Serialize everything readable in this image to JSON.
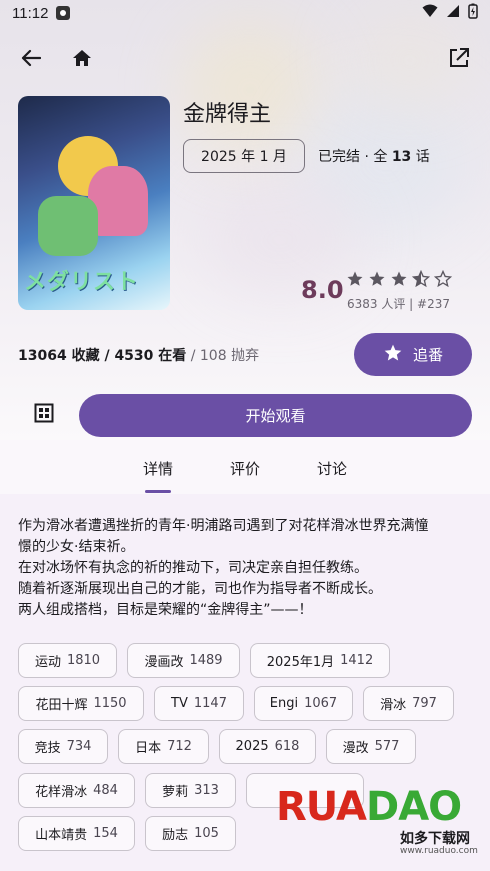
{
  "status_bar": {
    "time": "11:12"
  },
  "anime": {
    "title": "金牌得主",
    "date": "2025 年 1 月",
    "status_prefix": "已完结 · 全 ",
    "episodes": "13",
    "status_suffix": " 话",
    "score": "8.0",
    "rating_count": "6383 人评 | #237",
    "stars": 3.5
  },
  "stats": {
    "collected": "13064 收藏 / 4530 在看",
    "dropped": " / 108 抛弃"
  },
  "actions": {
    "follow": "追番",
    "watch": "开始观看"
  },
  "tabs": [
    {
      "label": "详情",
      "active": true
    },
    {
      "label": "评价",
      "active": false
    },
    {
      "label": "讨论",
      "active": false
    }
  ],
  "description": [
    "作为滑冰者遭遇挫折的青年·明浦路司遇到了对花样滑冰世界充满憧",
    "憬的少女·结束祈。",
    "在对冰场怀有执念的祈的推动下，司决定亲自担任教练。",
    "随着祈逐渐展现出自己的才能，司也作为指导者不断成长。",
    "两人组成搭档，目标是荣耀的“金牌得主”——！"
  ],
  "tags": [
    {
      "name": "运动",
      "count": "1810"
    },
    {
      "name": "漫画改",
      "count": "1489"
    },
    {
      "name": "2025年1月",
      "count": "1412"
    },
    {
      "name": "花田十辉",
      "count": "1150"
    },
    {
      "name": "TV",
      "count": "1147"
    },
    {
      "name": "Engi",
      "count": "1067"
    },
    {
      "name": "滑冰",
      "count": "797"
    },
    {
      "name": "竞技",
      "count": "734"
    },
    {
      "name": "日本",
      "count": "712"
    },
    {
      "name": "2025",
      "count": "618"
    },
    {
      "name": "漫改",
      "count": "577"
    },
    {
      "name": "花样滑冰",
      "count": "484"
    },
    {
      "name": "萝莉",
      "count": "313"
    },
    {
      "name": "山本靖贵",
      "count": "154"
    },
    {
      "name": "励志",
      "count": "105"
    }
  ],
  "colors": {
    "primary": "#6a4fa5",
    "score": "#6d3b5b",
    "watermark_red": "#d8281c",
    "watermark_green": "#39a935"
  },
  "watermark": {
    "brand": "RUADAO",
    "brand_a": "RUA",
    "brand_b": "DAO",
    "name": "如多下载网",
    "url": "www.ruaduo.com"
  }
}
